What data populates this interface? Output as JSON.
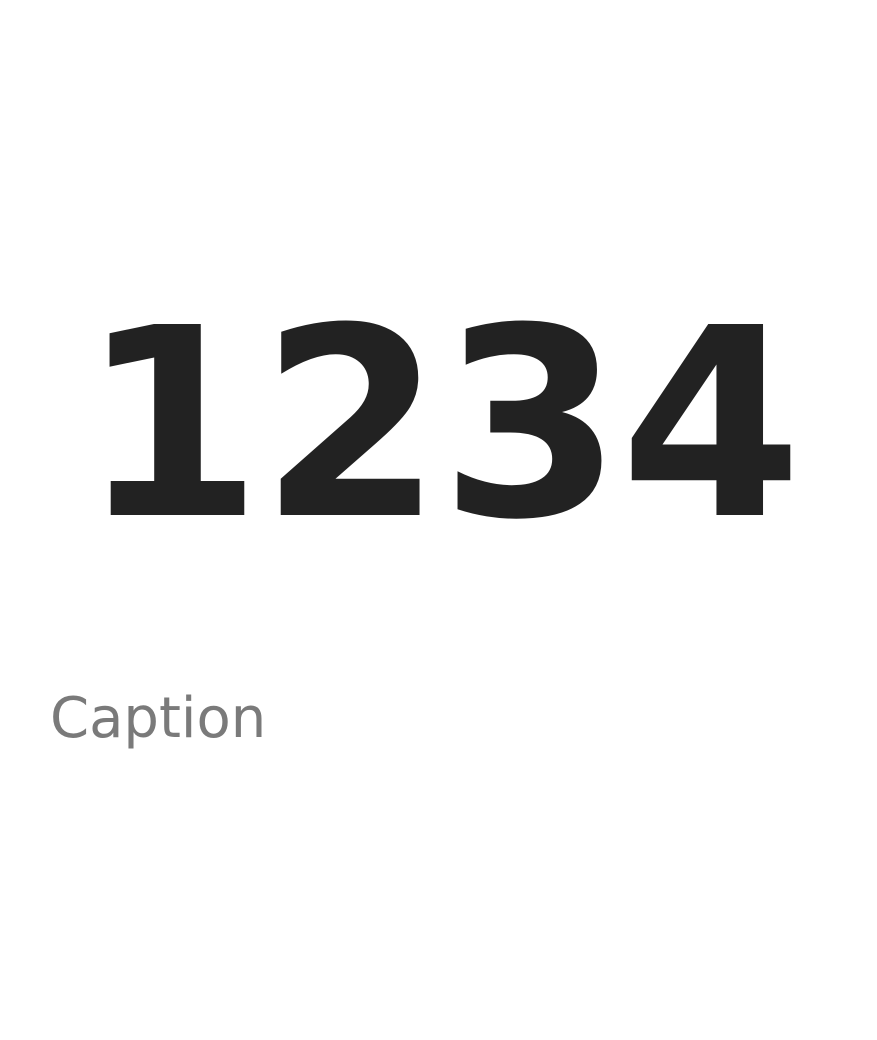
{
  "digits": {
    "d1": "1",
    "d2": "2",
    "d3": "3",
    "d4": "4"
  },
  "caption": {
    "text": "Caption"
  }
}
